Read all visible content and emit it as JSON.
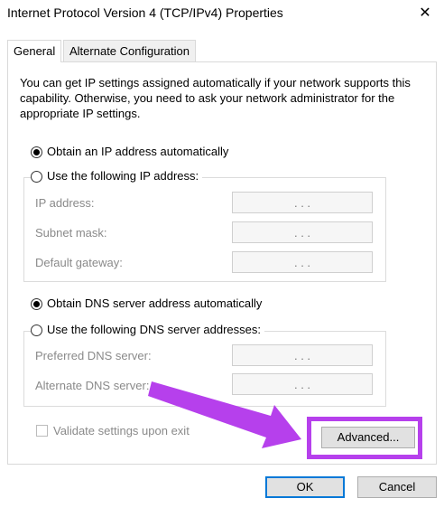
{
  "window": {
    "title": "Internet Protocol Version 4 (TCP/IPv4) Properties",
    "close_glyph": "✕"
  },
  "tabs": [
    {
      "label": "General",
      "active": true
    },
    {
      "label": "Alternate Configuration",
      "active": false
    }
  ],
  "general": {
    "description": "You can get IP settings assigned automatically if your network supports this capability. Otherwise, you need to ask your network administrator for the appropriate IP settings.",
    "ip_auto_label": "Obtain an IP address automatically",
    "ip_manual_label": "Use the following IP address:",
    "ip_mode_selected": "auto",
    "ip_fields": [
      {
        "label": "IP address:",
        "value": ". . ."
      },
      {
        "label": "Subnet mask:",
        "value": ". . ."
      },
      {
        "label": "Default gateway:",
        "value": ". . ."
      }
    ],
    "dns_auto_label": "Obtain DNS server address automatically",
    "dns_manual_label": "Use the following DNS server addresses:",
    "dns_mode_selected": "auto",
    "dns_fields": [
      {
        "label": "Preferred DNS server:",
        "value": ". . ."
      },
      {
        "label": "Alternate DNS server:",
        "value": ". . ."
      }
    ],
    "validate_label": "Validate settings upon exit",
    "validate_checked": false,
    "advanced_label": "Advanced..."
  },
  "footer": {
    "ok_label": "OK",
    "cancel_label": "Cancel"
  },
  "annotation": {
    "color": "#b640ec",
    "icon": "arrow-annotation-icon"
  }
}
